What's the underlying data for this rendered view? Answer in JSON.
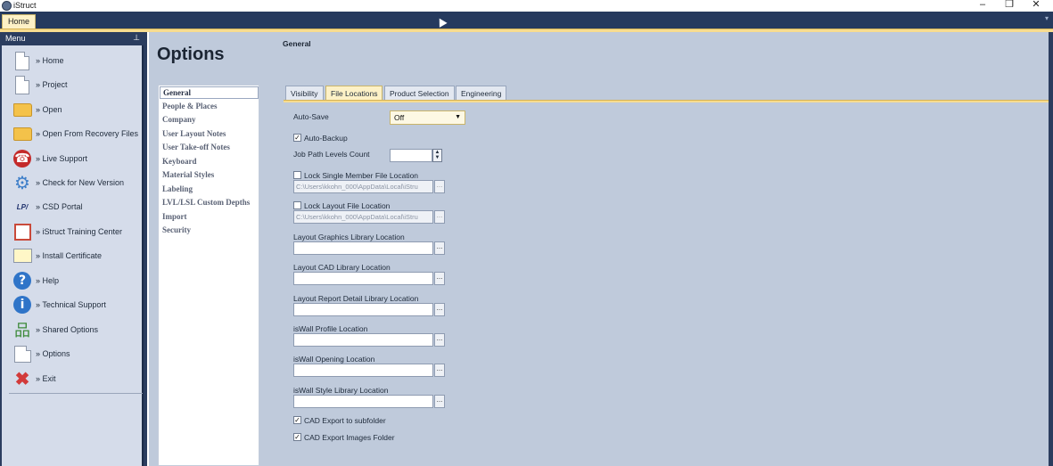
{
  "app": {
    "title": "iStruct"
  },
  "window": {
    "minimize": "–",
    "restore": "❐",
    "close": "✕"
  },
  "ribbon": {
    "home_tab": "Home",
    "collapse_caret": "▾"
  },
  "menu": {
    "header": "Menu",
    "pin": "📌",
    "items": [
      {
        "label": "» Home",
        "icon": "document-icon"
      },
      {
        "label": "» Project",
        "icon": "document-icon"
      },
      {
        "label": "» Open",
        "icon": "folder-icon"
      },
      {
        "label": "» Open From Recovery Files",
        "icon": "folder-icon"
      },
      {
        "label": "» Live Support",
        "icon": "phone-icon"
      },
      {
        "label": "» Check for New Version",
        "icon": "gear-icon"
      },
      {
        "label": "» CSD Portal",
        "icon": "csd-logo-icon"
      },
      {
        "label": "» iStruct Training Center",
        "icon": "calendar-icon"
      },
      {
        "label": "» Install Certificate",
        "icon": "certificate-icon"
      },
      {
        "label": "» Help",
        "icon": "help-icon"
      },
      {
        "label": "» Technical Support",
        "icon": "info-icon"
      },
      {
        "label": "» Shared Options",
        "icon": "network-icon"
      },
      {
        "label": "» Options",
        "icon": "options-icon"
      },
      {
        "label": "» Exit",
        "icon": "exit-icon"
      }
    ]
  },
  "options": {
    "title": "Options",
    "nav": [
      "General",
      "People & Places",
      "Company",
      "User Layout Notes",
      "User Take-off Notes",
      "Keyboard",
      "Material Styles",
      "Labeling",
      "LVL/LSL Custom Depths",
      "Import",
      "Security"
    ],
    "selected_nav": "General"
  },
  "general": {
    "section_title": "General",
    "tabs": [
      "Visibility",
      "File Locations",
      "Product Selection",
      "Engineering"
    ],
    "active_tab": "File Locations",
    "auto_save": {
      "label": "Auto-Save",
      "value": "Off"
    },
    "auto_backup": {
      "label": "Auto-Backup",
      "checked": true,
      "mark": "✓"
    },
    "job_path_levels": {
      "label": "Job Path Levels Count",
      "value": ""
    },
    "lock_single_member": {
      "label": "Lock Single Member File Location",
      "checked": false,
      "path": "C:\\Users\\kkohn_000\\AppData\\Local\\iStru"
    },
    "lock_layout": {
      "label": "Lock Layout File Location",
      "checked": false,
      "path": "C:\\Users\\kkohn_000\\AppData\\Local\\iStru"
    },
    "browse_label": "...",
    "layout_graphics": {
      "label": "Layout Graphics Library Location",
      "value": ""
    },
    "layout_cad": {
      "label": "Layout CAD Library Location",
      "value": ""
    },
    "layout_report": {
      "label": "Layout Report Detail Library Location",
      "value": ""
    },
    "iswall_profile": {
      "label": "isWall Profile Location",
      "value": ""
    },
    "iswall_opening": {
      "label": "isWall Opening Location",
      "value": ""
    },
    "iswall_style": {
      "label": "isWall Style Library Location",
      "value": ""
    },
    "cad_export_subfolder": {
      "label": "CAD Export to subfolder",
      "checked": true,
      "mark": "✓"
    },
    "cad_export_images": {
      "label": "CAD Export Images Folder",
      "checked": true,
      "mark": "✓"
    }
  }
}
